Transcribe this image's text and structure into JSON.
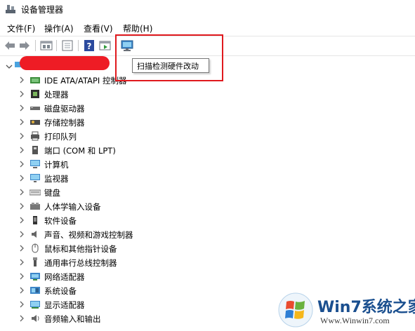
{
  "window": {
    "title": "设备管理器"
  },
  "menu": [
    {
      "label": "文件(F)"
    },
    {
      "label": "操作(A)"
    },
    {
      "label": "查看(V)"
    },
    {
      "label": "帮助(H)"
    }
  ],
  "toolbar": {
    "buttons": [
      "back-arrow-icon",
      "forward-arrow-icon",
      "properties-icon",
      "update-driver-icon",
      "help-icon",
      "run-icon",
      "scan-hardware-icon"
    ],
    "tooltip": "扫描检测硬件改动"
  },
  "tree": {
    "items": [
      {
        "label": "IDE ATA/ATAPI 控制器",
        "icon": "ide-controller-icon"
      },
      {
        "label": "处理器",
        "icon": "processor-icon"
      },
      {
        "label": "磁盘驱动器",
        "icon": "disk-drive-icon"
      },
      {
        "label": "存储控制器",
        "icon": "storage-controller-icon"
      },
      {
        "label": "打印队列",
        "icon": "printer-icon"
      },
      {
        "label": "端口 (COM 和 LPT)",
        "icon": "port-icon"
      },
      {
        "label": "计算机",
        "icon": "computer-icon"
      },
      {
        "label": "监视器",
        "icon": "monitor-icon"
      },
      {
        "label": "键盘",
        "icon": "keyboard-icon"
      },
      {
        "label": "人体学输入设备",
        "icon": "hid-icon"
      },
      {
        "label": "软件设备",
        "icon": "software-device-icon"
      },
      {
        "label": "声音、视频和游戏控制器",
        "icon": "sound-icon"
      },
      {
        "label": "鼠标和其他指针设备",
        "icon": "mouse-icon"
      },
      {
        "label": "通用串行总线控制器",
        "icon": "usb-icon"
      },
      {
        "label": "网络适配器",
        "icon": "network-adapter-icon"
      },
      {
        "label": "系统设备",
        "icon": "system-device-icon"
      },
      {
        "label": "显示适配器",
        "icon": "display-adapter-icon"
      },
      {
        "label": "音频输入和输出",
        "icon": "audio-io-icon"
      }
    ]
  },
  "watermark": {
    "brand": "Win7系统之家",
    "url": "Www.Winwin7.com"
  },
  "colors": {
    "highlight": "#e0191e",
    "redaction": "#ee1c25",
    "brand": "#1a4f8f"
  }
}
